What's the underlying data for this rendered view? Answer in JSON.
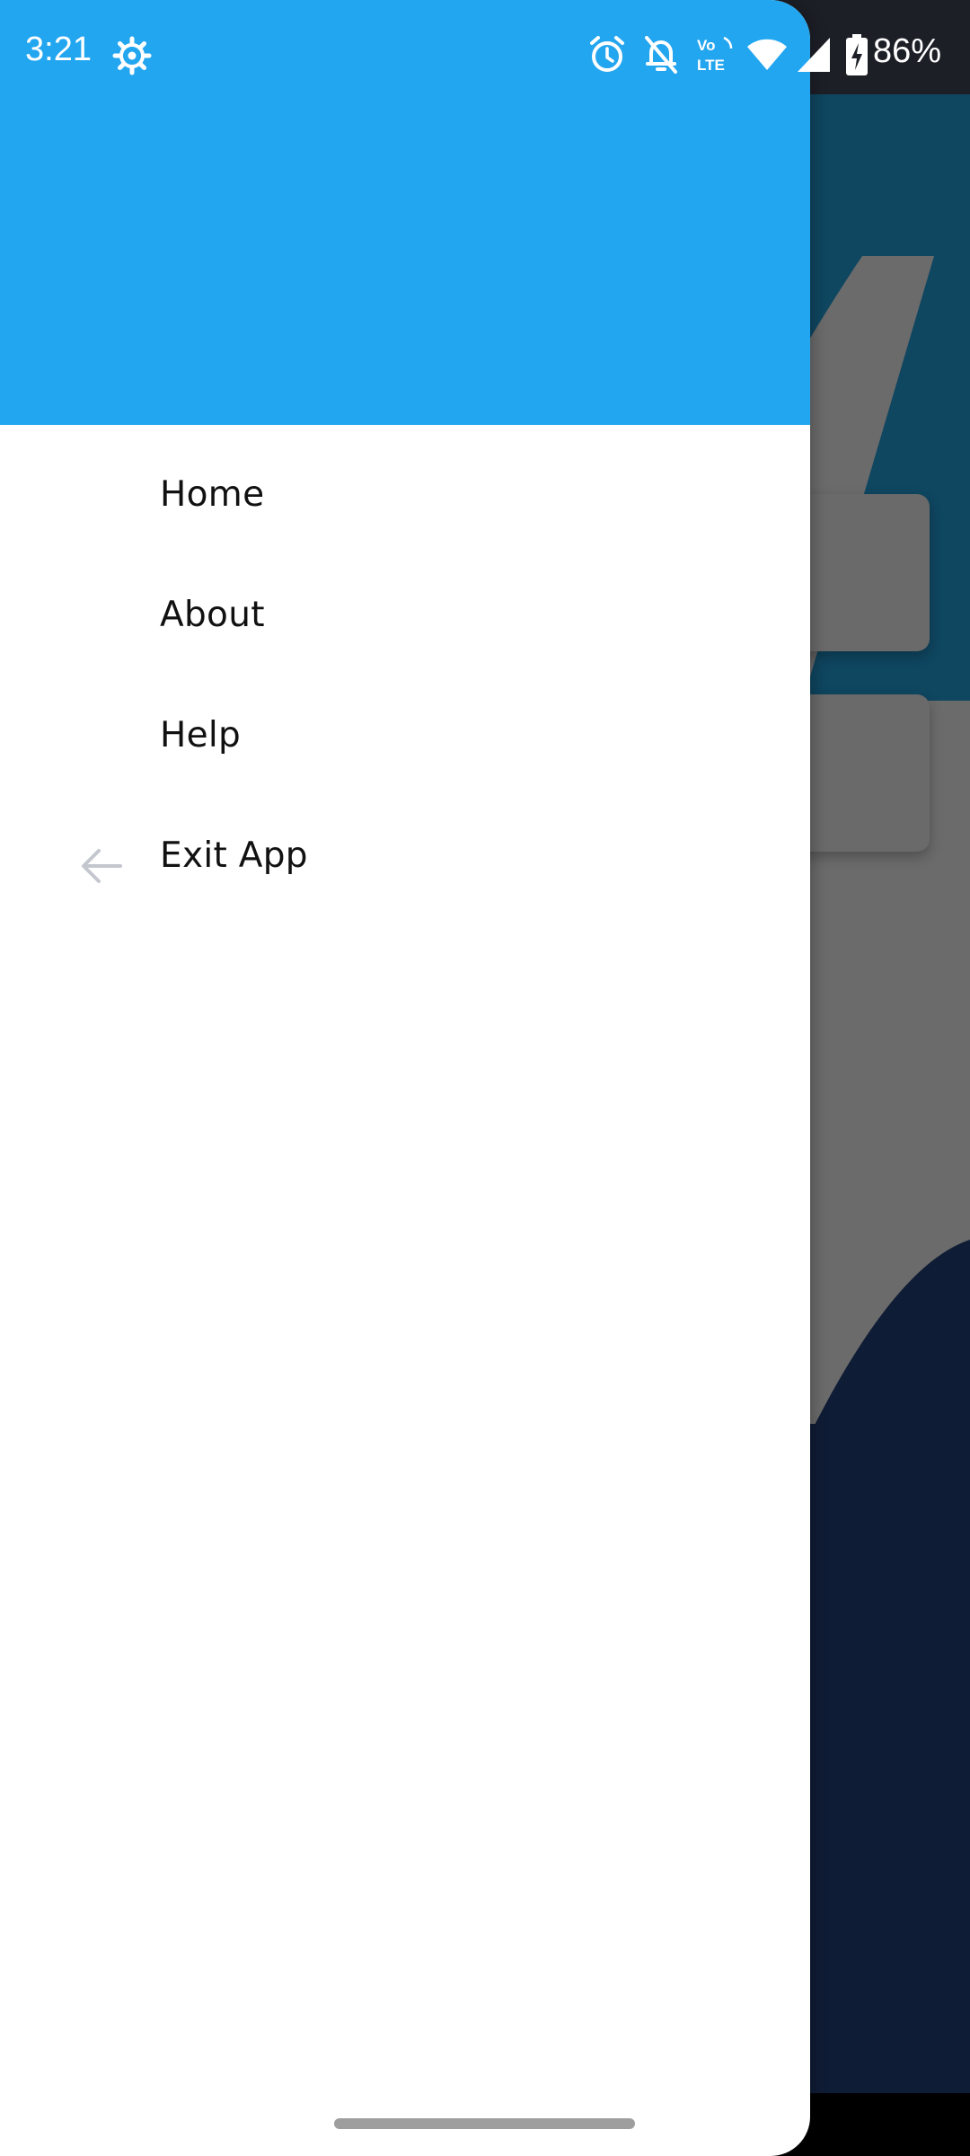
{
  "status_bar": {
    "time": "3:21",
    "battery_percent": "86%",
    "icons": [
      "gear-icon",
      "alarm-icon",
      "notifications-off-icon",
      "volte-icon",
      "wifi-icon",
      "signal-icon",
      "battery-charging-icon"
    ],
    "volte_label_top": "Vo",
    "volte_label_bottom": "LTE"
  },
  "drawer": {
    "header_color": "#23a6f0",
    "menu_items": [
      {
        "label": "Home",
        "icon": null
      },
      {
        "label": "About",
        "icon": null
      },
      {
        "label": "Help",
        "icon": null
      },
      {
        "label": "Exit App",
        "icon": "arrow-left-icon"
      }
    ]
  },
  "colors": {
    "drawer_header": "#23a6f0",
    "icon_grey": "#c5c7cf",
    "background_dark": "#0f1c35"
  }
}
